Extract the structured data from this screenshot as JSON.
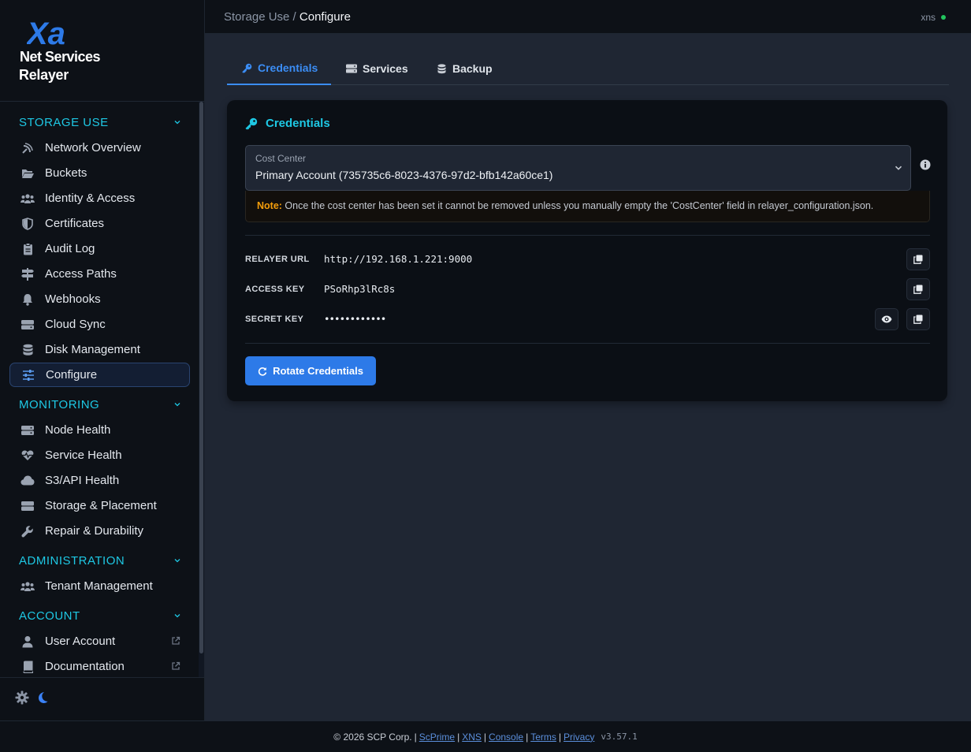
{
  "brand": {
    "logo_letters": "Xa",
    "line1": "Net Services",
    "line2": "Relayer"
  },
  "sidebar": {
    "sections": [
      {
        "title": "STORAGE USE",
        "items": [
          {
            "label": "Network Overview",
            "icon": "satellite-dish-icon"
          },
          {
            "label": "Buckets",
            "icon": "folder-open-icon"
          },
          {
            "label": "Identity & Access",
            "icon": "users-icon"
          },
          {
            "label": "Certificates",
            "icon": "shield-icon"
          },
          {
            "label": "Audit Log",
            "icon": "clipboard-icon"
          },
          {
            "label": "Access Paths",
            "icon": "signpost-icon"
          },
          {
            "label": "Webhooks",
            "icon": "bell-icon"
          },
          {
            "label": "Cloud Sync",
            "icon": "server-icon"
          },
          {
            "label": "Disk Management",
            "icon": "database-icon"
          },
          {
            "label": "Configure",
            "icon": "sliders-icon",
            "active": true
          }
        ]
      },
      {
        "title": "MONITORING",
        "items": [
          {
            "label": "Node Health",
            "icon": "server-icon"
          },
          {
            "label": "Service Health",
            "icon": "heart-pulse-icon"
          },
          {
            "label": "S3/API Health",
            "icon": "cloud-icon"
          },
          {
            "label": "Storage & Placement",
            "icon": "hard-drive-icon"
          },
          {
            "label": "Repair & Durability",
            "icon": "wrench-icon"
          }
        ]
      },
      {
        "title": "ADMINISTRATION",
        "items": [
          {
            "label": "Tenant Management",
            "icon": "users-icon"
          }
        ]
      },
      {
        "title": "ACCOUNT",
        "items": [
          {
            "label": "User Account",
            "icon": "user-icon",
            "external": true
          },
          {
            "label": "Documentation",
            "icon": "book-icon",
            "external": true
          }
        ]
      }
    ]
  },
  "topbar": {
    "breadcrumb_parent": "Storage Use",
    "breadcrumb_sep": " / ",
    "breadcrumb_current": "Configure",
    "user": "xns",
    "status_color": "#22c55e"
  },
  "tabs": [
    {
      "label": "Credentials",
      "icon": "key-icon",
      "active": true
    },
    {
      "label": "Services",
      "icon": "server-icon"
    },
    {
      "label": "Backup",
      "icon": "database-icon"
    }
  ],
  "card": {
    "title": "Credentials",
    "cost_center": {
      "label": "Cost Center",
      "value": "Primary Account (735735c6-8023-4376-97d2-bfb142a60ce1)"
    },
    "note_label": "Note:",
    "note_text": " Once the cost center has been set it cannot be removed unless you manually empty the 'CostCenter' field in relayer_configuration.json.",
    "fields": [
      {
        "key": "RELAYER URL",
        "value": "http://192.168.1.221:9000"
      },
      {
        "key": "ACCESS KEY",
        "value": "PSoRhp3lRc8s"
      },
      {
        "key": "SECRET KEY",
        "value": "••••••••••••"
      }
    ],
    "rotate_label": "Rotate Credentials"
  },
  "footer": {
    "copyright": "© 2026 SCP Corp.",
    "links": [
      "ScPrime",
      "XNS",
      "Console",
      "Terms",
      "Privacy"
    ],
    "version": "v3.57.1"
  },
  "colors": {
    "accent": "#1ec8e4",
    "primary": "#2d7ae8",
    "warning": "#f59e0b"
  }
}
